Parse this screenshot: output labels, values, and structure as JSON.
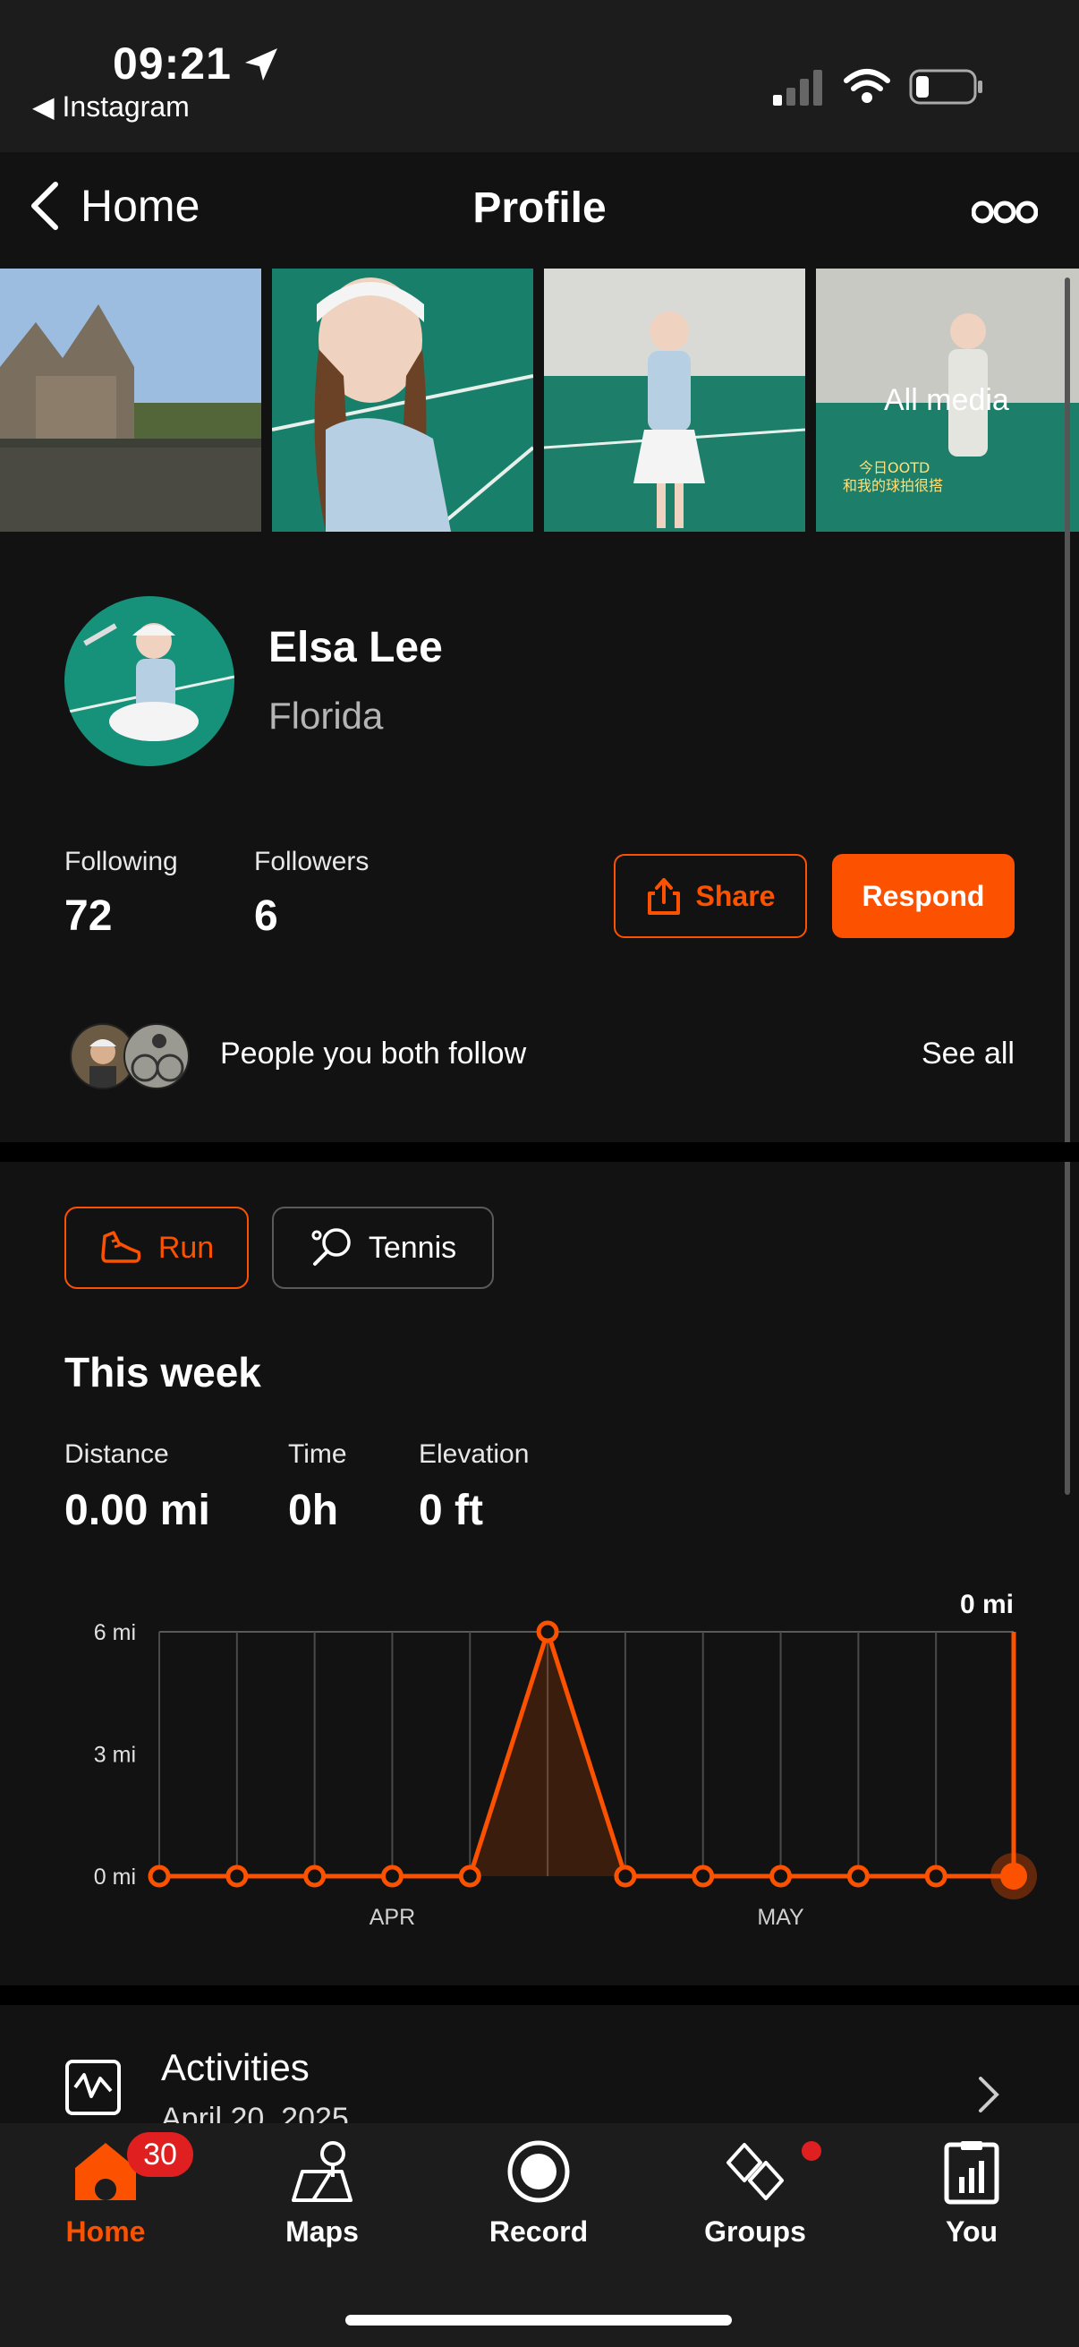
{
  "status_bar": {
    "time": "09:21",
    "back_app": "◀ Instagram"
  },
  "nav": {
    "back_label": "Home",
    "title": "Profile"
  },
  "media": {
    "all_media_label": "All media",
    "overlay_text": "今日OOTD\n和我的球拍很搭"
  },
  "profile": {
    "name": "Elsa Lee",
    "location": "Florida"
  },
  "stats": {
    "following_label": "Following",
    "following_value": "72",
    "followers_label": "Followers",
    "followers_value": "6"
  },
  "actions": {
    "share_label": "Share",
    "respond_label": "Respond"
  },
  "mutual": {
    "text": "People you both follow",
    "see_all": "See all"
  },
  "sport_tabs": [
    {
      "label": "Run",
      "selected": true
    },
    {
      "label": "Tennis",
      "selected": false
    }
  ],
  "week": {
    "title": "This week",
    "metrics": [
      {
        "label": "Distance",
        "value": "0.00 mi"
      },
      {
        "label": "Time",
        "value": "0h"
      },
      {
        "label": "Elevation",
        "value": "0 ft"
      }
    ]
  },
  "chart_data": {
    "type": "area",
    "series": [
      {
        "values": [
          0,
          0,
          0,
          0,
          0,
          6,
          0,
          0,
          0,
          0,
          0,
          0
        ]
      }
    ],
    "y_ticks": [
      "0 mi",
      "3 mi",
      "6 mi"
    ],
    "x_labels": [
      {
        "index": 3,
        "label": "APR"
      },
      {
        "index": 8,
        "label": "MAY"
      }
    ],
    "ylim": [
      0,
      6
    ],
    "current_value_label": "0 mi",
    "accent": "#fc5200",
    "grid": true
  },
  "activities": {
    "title": "Activities",
    "date": "April 20, 2025"
  },
  "tabbar": {
    "items": [
      {
        "label": "Home",
        "active": true
      },
      {
        "label": "Maps",
        "active": false
      },
      {
        "label": "Record",
        "active": false
      },
      {
        "label": "Groups",
        "active": false
      },
      {
        "label": "You",
        "active": false
      }
    ],
    "home_badge": "30"
  },
  "colors": {
    "accent": "#fc5200",
    "background": "#121212",
    "badge": "#e02020"
  }
}
